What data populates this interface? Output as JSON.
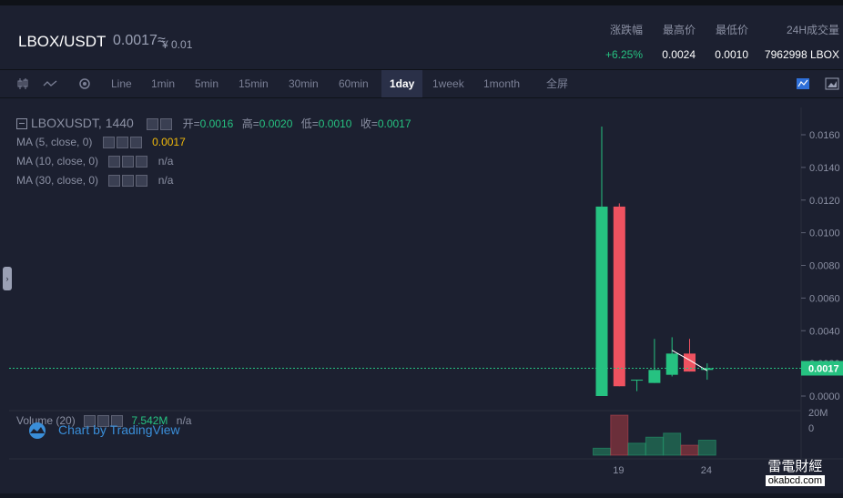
{
  "header": {
    "pair": "LBOX/USDT",
    "price": "0.0017≈",
    "cny": "¥ 0.01",
    "stats": [
      {
        "label": "涨跌幅",
        "value": "+6.25%",
        "color": "#26c281"
      },
      {
        "label": "最高价",
        "value": "0.0024",
        "color": "#ffffff"
      },
      {
        "label": "最低价",
        "value": "0.0010",
        "color": "#ffffff"
      },
      {
        "label": "24H成交量",
        "value": "7962998 LBOX",
        "color": "#ffffff"
      }
    ]
  },
  "toolbar": {
    "icons": [
      "candlestick-icon",
      "line-chart-icon",
      "settings-icon"
    ],
    "intervals": [
      "Line",
      "1min",
      "5min",
      "15min",
      "30min",
      "60min",
      "1day",
      "1week",
      "1month",
      "全屏"
    ],
    "active_interval": "1day",
    "right_icons": [
      "indicator-icon",
      "chart-type-icon"
    ]
  },
  "legend": {
    "symbol": "LBOXUSDT, 1440",
    "ohlc": [
      {
        "label": "开=",
        "value": "0.0016"
      },
      {
        "label": "高=",
        "value": "0.0020"
      },
      {
        "label": "低=",
        "value": "0.0010"
      },
      {
        "label": "收=",
        "value": "0.0017"
      }
    ],
    "ma": [
      {
        "label": "MA (5, close, 0)",
        "value": "0.0017",
        "color": "#f0b90b"
      },
      {
        "label": "MA (10, close, 0)",
        "value": "n/a",
        "color": "#8b90a3"
      },
      {
        "label": "MA (30, close, 0)",
        "value": "n/a",
        "color": "#8b90a3"
      }
    ],
    "volume_label": "Volume (20)",
    "volume_value": "7.542M",
    "volume_extra": "n/a",
    "branding": "Chart by TradingView"
  },
  "chart_data": {
    "type": "candlestick",
    "y_ticks": [
      "0.0160",
      "0.0140",
      "0.0120",
      "0.0100",
      "0.0080",
      "0.0060",
      "0.0040",
      "0.0020",
      "0.0000"
    ],
    "ylim": [
      0,
      0.0165
    ],
    "x_ticks": [
      "19",
      "24"
    ],
    "last_price_label": "0.0017",
    "volume_axis_label": "20M",
    "volume_axis_zero": "0",
    "candles": [
      {
        "day": 18,
        "open": 0.0,
        "high": 0.0165,
        "low": 0.0,
        "close": 0.0116
      },
      {
        "day": 19,
        "open": 0.0116,
        "high": 0.0118,
        "low": 0.0006,
        "close": 0.0006
      },
      {
        "day": 20,
        "open": 0.001,
        "high": 0.001,
        "low": 0.0003,
        "close": 0.001
      },
      {
        "day": 21,
        "open": 0.0008,
        "high": 0.0035,
        "low": 0.0008,
        "close": 0.0016
      },
      {
        "day": 22,
        "open": 0.0013,
        "high": 0.0036,
        "low": 0.0012,
        "close": 0.0026
      },
      {
        "day": 23,
        "open": 0.0026,
        "high": 0.0035,
        "low": 0.0015,
        "close": 0.0015
      },
      {
        "day": 24,
        "open": 0.0016,
        "high": 0.002,
        "low": 0.001,
        "close": 0.0017
      }
    ],
    "volume": [
      {
        "day": 18,
        "value": 3.5,
        "up": true
      },
      {
        "day": 19,
        "value": 20,
        "up": false
      },
      {
        "day": 20,
        "value": 6,
        "up": true
      },
      {
        "day": 21,
        "value": 9,
        "up": true
      },
      {
        "day": 22,
        "value": 11,
        "up": true
      },
      {
        "day": 23,
        "value": 5,
        "up": false
      },
      {
        "day": 24,
        "value": 7.5,
        "up": true
      }
    ],
    "colors": {
      "up": "#26c281",
      "down": "#ef5260",
      "grid": "#2a2e3d",
      "last_line": "#26c281"
    }
  },
  "watermark": {
    "text": "雷電財經",
    "domain": "okabcd.com"
  }
}
